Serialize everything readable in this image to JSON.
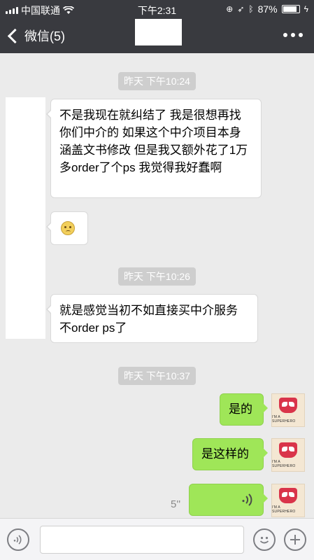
{
  "status_bar": {
    "carrier": "中国联通",
    "time": "下午2:31",
    "battery": "87%",
    "battery_level": 0.87
  },
  "nav": {
    "back_label": "微信(5)",
    "more_icon": "more-dots-icon"
  },
  "messages": {
    "ts1": "昨天 下午10:24",
    "msg1": "不是我现在就纠结了 我是很想再找你们中介的 如果这个中介项目本身涵盖文书修改 但是我又额外花了1万多order了个ps 我觉得我好蠢啊",
    "msg2_emoji": "worried-face-emoji",
    "ts2": "昨天 下午10:26",
    "msg3": "就是感觉当初不如直接买中介服务 不order ps了",
    "ts3": "昨天 下午10:37",
    "msg4": "是的",
    "msg5": "是这样的",
    "voice_duration": "5''",
    "avatar_caption": "I'M A SUPERHERO"
  },
  "input_bar": {
    "voice_icon": "voice-mode-icon",
    "emoji_icon": "emoji-icon",
    "plus_icon": "plus-icon"
  },
  "colors": {
    "nav_bg": "#393a3f",
    "chat_bg": "#ebebeb",
    "my_bubble": "#9fe658"
  }
}
